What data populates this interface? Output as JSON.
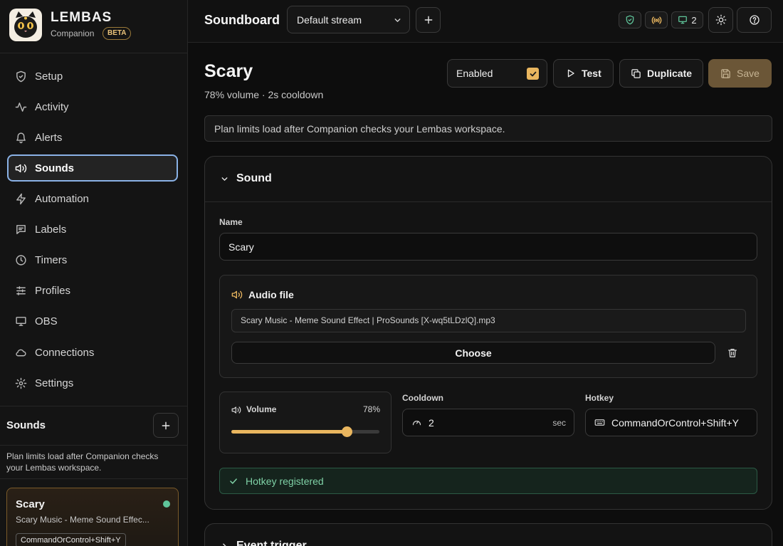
{
  "brand": {
    "name": "LEMBAS",
    "subtitle": "Companion",
    "badge": "BETA"
  },
  "nav": [
    {
      "label": "Setup",
      "icon": "shield-check-icon"
    },
    {
      "label": "Activity",
      "icon": "activity-icon"
    },
    {
      "label": "Alerts",
      "icon": "bell-icon"
    },
    {
      "label": "Sounds",
      "icon": "speaker-icon",
      "active": true
    },
    {
      "label": "Automation",
      "icon": "lightning-icon"
    },
    {
      "label": "Labels",
      "icon": "label-icon"
    },
    {
      "label": "Timers",
      "icon": "clock-icon"
    },
    {
      "label": "Profiles",
      "icon": "sliders-icon"
    },
    {
      "label": "OBS",
      "icon": "monitor-icon"
    },
    {
      "label": "Connections",
      "icon": "cloud-icon"
    },
    {
      "label": "Settings",
      "icon": "gear-icon"
    }
  ],
  "sidebar_sounds": {
    "title": "Sounds",
    "note": "Plan limits load after Companion checks your Lembas workspace.",
    "card": {
      "title": "Scary",
      "subtitle": "Scary Music - Meme Sound Effec...",
      "hotkey": "CommandOrControl+Shift+Y"
    }
  },
  "topbar": {
    "title": "Soundboard",
    "stream": "Default stream",
    "monitor_count": "2"
  },
  "page": {
    "title": "Scary",
    "subtitle": "78% volume · 2s cooldown",
    "enabled_label": "Enabled",
    "enabled": true,
    "test_label": "Test",
    "duplicate_label": "Duplicate",
    "save_label": "Save",
    "banner": "Plan limits load after Companion checks your Lembas workspace."
  },
  "sound_section": {
    "title": "Sound",
    "name_label": "Name",
    "name_value": "Scary",
    "audio_title": "Audio file",
    "file_name": "Scary Music - Meme Sound Effect  |  ProSounds [X-wq5tLDzlQ].mp3",
    "choose_label": "Choose",
    "volume_label": "Volume",
    "volume_text": "78%",
    "volume_value": 78,
    "cooldown_label": "Cooldown",
    "cooldown_value": "2",
    "cooldown_unit": "sec",
    "hotkey_label": "Hotkey",
    "hotkey_value": "CommandOrControl+Shift+Y",
    "hotkey_status": "Hotkey registered"
  },
  "event_section": {
    "title": "Event trigger"
  },
  "colors": {
    "accent": "#e9b65f",
    "active_border": "#8ab2e6",
    "success": "#7fd1a6"
  }
}
